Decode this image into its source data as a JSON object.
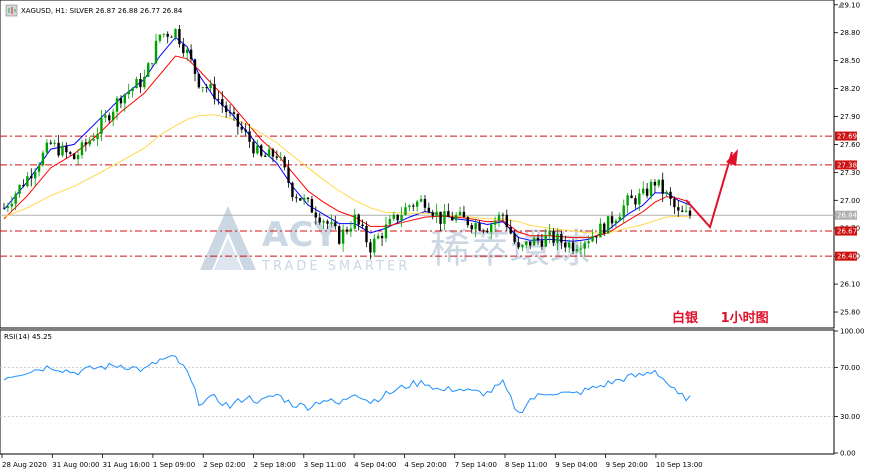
{
  "header": {
    "title": "XAGUSD, H1:  SILVER  26.87 26.88 26.77 26.84",
    "rsi_label": "RSI(14) 45.25"
  },
  "annotations": {
    "chart_caption": "白银     1小时图"
  },
  "watermark": {
    "brand": "ACY",
    "tagline": "TRADE SMARTER",
    "cn_name": "稀萃環球"
  },
  "colors": {
    "bull_candle": "#00a000",
    "bear_candle": "#000000",
    "ma_fast": "#0000ff",
    "ma_mid": "#ff0000",
    "ma_slow": "#ffd84a",
    "rsi_line": "#1e90ff",
    "level_line": "#d01010",
    "current_price": "#b0b0b0",
    "annotation_arrow": "#e0102a"
  },
  "chart_data": [
    {
      "type": "candlestick",
      "symbol": "XAGUSD",
      "timeframe": "H1",
      "description": "SILVER",
      "ohlc_last": {
        "open": 26.87,
        "high": 26.88,
        "low": 26.77,
        "close": 26.84
      },
      "ylim": [
        25.65,
        29.13
      ],
      "y_ticks": [
        "29.10",
        "28.80",
        "28.50",
        "28.20",
        "27.90",
        "27.60",
        "27.30",
        "27.00",
        "26.70",
        "26.40",
        "26.10",
        "25.80"
      ],
      "x_tick_labels": [
        "28 Aug 2020",
        "31 Aug 00:00",
        "31 Aug 16:00",
        "1 Sep 09:00",
        "2 Sep 02:00",
        "2 Sep 18:00",
        "3 Sep 11:00",
        "4 Sep 04:00",
        "4 Sep 20:00",
        "7 Sep 14:00",
        "8 Sep 11:00",
        "9 Sep 04:00",
        "9 Sep 20:00",
        "10 Sep 13:00"
      ],
      "close_path": [
        [
          0,
          26.92
        ],
        [
          6,
          27.25
        ],
        [
          12,
          27.6
        ],
        [
          18,
          27.45
        ],
        [
          24,
          27.75
        ],
        [
          30,
          28.12
        ],
        [
          36,
          28.3
        ],
        [
          40,
          28.78
        ],
        [
          44,
          28.82
        ],
        [
          47,
          28.58
        ],
        [
          50,
          28.28
        ],
        [
          54,
          28.15
        ],
        [
          58,
          27.9
        ],
        [
          62,
          27.7
        ],
        [
          66,
          27.45
        ],
        [
          70,
          27.5
        ],
        [
          74,
          27.1
        ],
        [
          78,
          26.95
        ],
        [
          82,
          26.8
        ],
        [
          86,
          26.6
        ],
        [
          90,
          26.8
        ],
        [
          94,
          26.5
        ],
        [
          98,
          26.7
        ],
        [
          104,
          26.95
        ],
        [
          108,
          27.0
        ],
        [
          112,
          26.8
        ],
        [
          116,
          26.82
        ],
        [
          120,
          26.76
        ],
        [
          124,
          26.72
        ],
        [
          128,
          26.85
        ],
        [
          132,
          26.45
        ],
        [
          135,
          26.55
        ],
        [
          140,
          26.6
        ],
        [
          146,
          26.52
        ],
        [
          150,
          26.6
        ],
        [
          155,
          26.75
        ],
        [
          160,
          26.98
        ],
        [
          164,
          27.05
        ],
        [
          167,
          27.2
        ],
        [
          170,
          27.05
        ],
        [
          173,
          26.85
        ],
        [
          176,
          26.84
        ]
      ],
      "moving_averages": [
        {
          "color": "#0000ff",
          "values": [
            26.9,
            27.2,
            27.55,
            27.6,
            27.85,
            28.1,
            28.3,
            28.55,
            28.75,
            28.65,
            28.35,
            28.1,
            27.95,
            27.75,
            27.55,
            27.4,
            27.15,
            26.95,
            26.85,
            26.75,
            26.75,
            26.65,
            26.7,
            26.82,
            26.88,
            26.85,
            26.8,
            26.78,
            26.74,
            26.77,
            26.6,
            26.57,
            26.58,
            26.56,
            26.58,
            26.68,
            26.85,
            26.95,
            27.08,
            27.08,
            27.0,
            26.95
          ]
        },
        {
          "color": "#ff0000",
          "values": [
            26.8,
            27.05,
            27.35,
            27.5,
            27.7,
            27.95,
            28.15,
            28.35,
            28.55,
            28.52,
            28.4,
            28.22,
            28.05,
            27.85,
            27.65,
            27.5,
            27.3,
            27.1,
            26.98,
            26.88,
            26.82,
            26.72,
            26.72,
            26.78,
            26.82,
            26.83,
            26.82,
            26.8,
            26.77,
            26.78,
            26.66,
            26.62,
            26.62,
            26.6,
            26.6,
            26.65,
            26.78,
            26.88,
            26.98,
            27.04,
            27.02,
            26.98
          ]
        },
        {
          "color": "#ffd84a",
          "values": [
            26.82,
            26.92,
            27.05,
            27.15,
            27.28,
            27.42,
            27.56,
            27.7,
            27.8,
            27.87,
            27.91,
            27.92,
            27.88,
            27.82,
            27.72,
            27.62,
            27.48,
            27.35,
            27.22,
            27.1,
            27.0,
            26.92,
            26.87,
            26.86,
            26.86,
            26.85,
            26.83,
            26.82,
            26.8,
            26.8,
            26.77,
            26.73,
            26.7,
            26.67,
            26.65,
            26.65,
            26.7,
            26.74,
            26.78,
            26.82,
            26.83,
            26.82
          ]
        }
      ],
      "horizontal_levels": [
        27.69,
        27.38,
        26.67,
        26.4
      ],
      "current_price": 26.84
    },
    {
      "type": "line",
      "name": "RSI(14)",
      "last_value": 45.25,
      "ylim": [
        0,
        100
      ],
      "y_ticks": [
        "100.00",
        "70.00",
        "30.00",
        "0.00"
      ],
      "levels": [
        70,
        30
      ],
      "x": [
        0,
        6,
        12,
        18,
        24,
        30,
        36,
        40,
        44,
        47,
        50,
        54,
        58,
        62,
        66,
        70,
        74,
        78,
        82,
        86,
        90,
        94,
        98,
        104,
        108,
        112,
        116,
        120,
        124,
        128,
        132,
        135,
        140,
        146,
        150,
        155,
        160,
        164,
        167,
        170,
        173,
        176
      ],
      "values": [
        62,
        67,
        71,
        66,
        70,
        72,
        68,
        76,
        78,
        66,
        42,
        45,
        38,
        46,
        42,
        48,
        40,
        38,
        44,
        40,
        50,
        42,
        48,
        56,
        58,
        51,
        53,
        50,
        49,
        57,
        32,
        44,
        50,
        48,
        52,
        57,
        62,
        64,
        68,
        58,
        47,
        45
      ]
    }
  ]
}
